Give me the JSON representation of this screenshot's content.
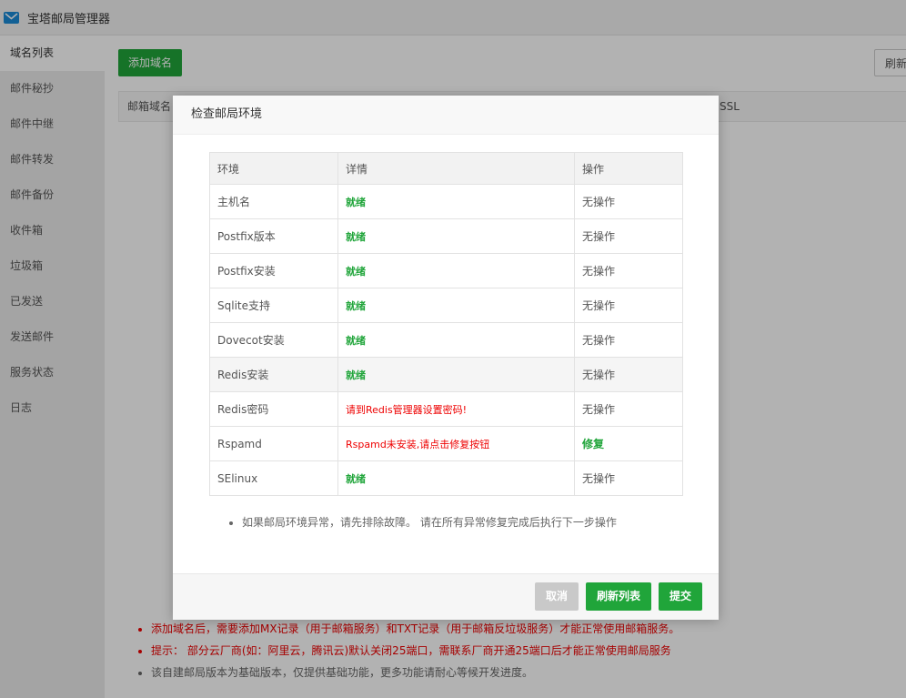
{
  "app": {
    "title": "宝塔邮局管理器",
    "icon": "mail-icon"
  },
  "sidebar": {
    "items": [
      {
        "label": "域名列表",
        "active": true
      },
      {
        "label": "邮件秘抄"
      },
      {
        "label": "邮件中继"
      },
      {
        "label": "邮件转发"
      },
      {
        "label": "邮件备份"
      },
      {
        "label": "收件箱"
      },
      {
        "label": "垃圾箱"
      },
      {
        "label": "已发送"
      },
      {
        "label": "发送邮件"
      },
      {
        "label": "服务状态"
      },
      {
        "label": "日志"
      }
    ]
  },
  "main": {
    "add_button": "添加域名",
    "refresh_button": "刷新",
    "table_headers": [
      "邮箱域名",
      "SSL"
    ],
    "notes": [
      "添加域名后，需要添加MX记录（用于邮箱服务）和TXT记录（用于邮箱反垃圾服务）才能正常使用邮箱服务。",
      "提示： 部分云厂商(如：阿里云，腾讯云)默认关闭25端口，需联系厂商开通25端口后才能正常使用邮局服务",
      "该自建邮局版本为基础版本，仅提供基础功能，更多功能请耐心等候开发进度。"
    ]
  },
  "modal": {
    "title": "检查邮局环境",
    "columns": [
      "环境",
      "详情",
      "操作"
    ],
    "rows": [
      {
        "env": "主机名",
        "detail": "就绪",
        "action": "无操作"
      },
      {
        "env": "Postfix版本",
        "detail": "就绪",
        "action": "无操作"
      },
      {
        "env": "Postfix安装",
        "detail": "就绪",
        "action": "无操作"
      },
      {
        "env": "Sqlite支持",
        "detail": "就绪",
        "action": "无操作"
      },
      {
        "env": "Dovecot安装",
        "detail": "就绪",
        "action": "无操作"
      },
      {
        "env": "Redis安装",
        "detail": "就绪",
        "action": "无操作"
      },
      {
        "env": "Redis密码",
        "detail": "请到Redis管理器设置密码!",
        "action": "无操作"
      },
      {
        "env": "Rspamd",
        "detail": "Rspamd未安装,请点击修复按钮",
        "action": "修复"
      },
      {
        "env": "SElinux",
        "detail": "就绪",
        "action": "无操作"
      }
    ],
    "note": "如果邮局环境异常，请先排除故障。 请在所有异常修复完成后执行下一步操作",
    "buttons": {
      "cancel": "取消",
      "refresh": "刷新列表",
      "submit": "提交"
    }
  },
  "colors": {
    "accent_green": "#20a53a",
    "error_red": "#ee0000"
  }
}
